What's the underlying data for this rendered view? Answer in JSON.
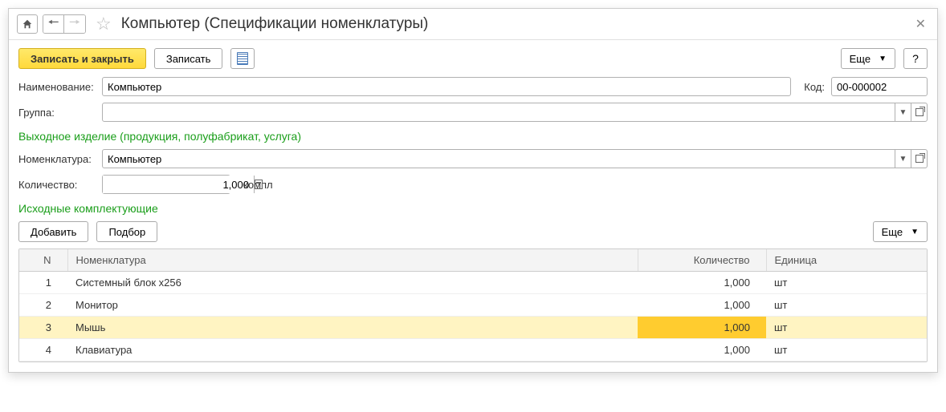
{
  "titlebar": {
    "title": "Компьютер (Спецификации номенклатуры)"
  },
  "toolbar": {
    "save_close": "Записать и закрыть",
    "save": "Записать",
    "more": "Еще",
    "help": "?"
  },
  "fields": {
    "name_label": "Наименование:",
    "name_value": "Компьютер",
    "code_label": "Код:",
    "code_value": "00-000002",
    "group_label": "Группа:",
    "group_value": ""
  },
  "output_section": {
    "header": "Выходное изделие (продукция, полуфабрикат, услуга)",
    "nomenclature_label": "Номенклатура:",
    "nomenclature_value": "Компьютер",
    "qty_label": "Количество:",
    "qty_value": "1,000",
    "unit": "компл"
  },
  "components_section": {
    "header": "Исходные комплектующие",
    "add": "Добавить",
    "select": "Подбор",
    "more": "Еще"
  },
  "table": {
    "headers": {
      "n": "N",
      "nomenclature": "Номенклатура",
      "qty": "Количество",
      "unit": "Единица"
    },
    "rows": [
      {
        "n": "1",
        "name": "Системный блок x256",
        "qty": "1,000",
        "unit": "шт",
        "selected": false
      },
      {
        "n": "2",
        "name": "Монитор",
        "qty": "1,000",
        "unit": "шт",
        "selected": false
      },
      {
        "n": "3",
        "name": "Мышь",
        "qty": "1,000",
        "unit": "шт",
        "selected": true
      },
      {
        "n": "4",
        "name": "Клавиатура",
        "qty": "1,000",
        "unit": "шт",
        "selected": false
      }
    ]
  }
}
